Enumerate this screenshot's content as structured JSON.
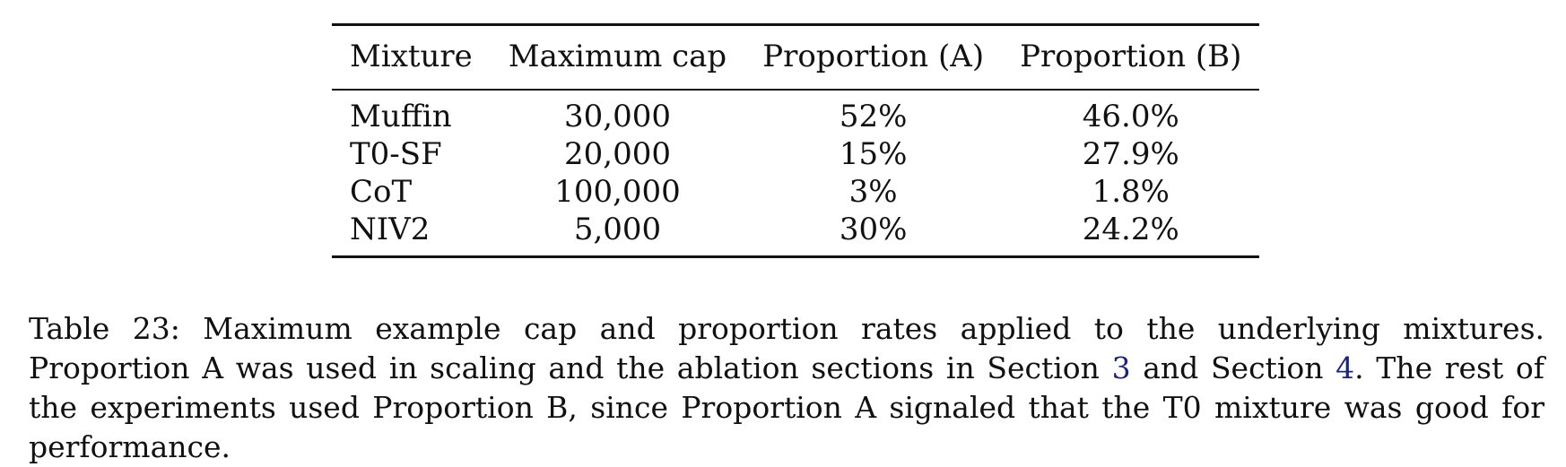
{
  "table": {
    "headers": [
      "Mixture",
      "Maximum cap",
      "Proportion (A)",
      "Proportion (B)"
    ],
    "rows": [
      [
        "Muffin",
        "30,000",
        "52%",
        "46.0%"
      ],
      [
        "T0-SF",
        "20,000",
        "15%",
        "27.9%"
      ],
      [
        "CoT",
        "100,000",
        "3%",
        "1.8%"
      ],
      [
        "NIV2",
        "5,000",
        "30%",
        "24.2%"
      ]
    ]
  },
  "caption": {
    "part1": "Table 23: Maximum example cap and proportion rates applied to the underlying mixtures. Proportion A was used in scaling and the ablation sections in Section ",
    "ref1": "3",
    "part2": " and Section ",
    "ref2": "4",
    "part3": ". The rest of the experiments used Proportion B, since Proportion A signaled that the T0 mixture was good for performance."
  },
  "colors": {
    "text": "#111111",
    "link": "#1a237e"
  }
}
